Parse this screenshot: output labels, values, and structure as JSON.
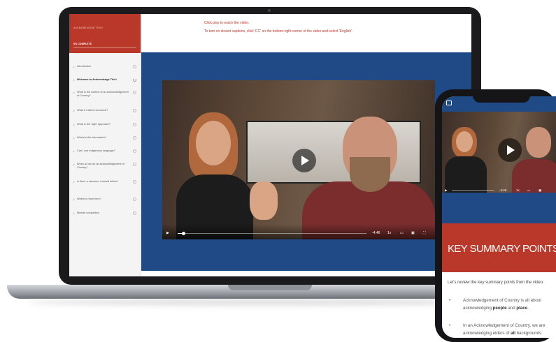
{
  "sidebar": {
    "course_title": "ACKNOWLEDGE THIS!",
    "progress_label": "0% COMPLETE",
    "lessons": [
      {
        "label": "Introduction"
      },
      {
        "label": "Welcome to Acknowledge This!"
      },
      {
        "label": "What is the context of an Acknowledgement of Country?"
      },
      {
        "label": "What if I offend someone?"
      },
      {
        "label": "What is the 'right' approach?"
      },
      {
        "label": "Where's the information?"
      },
      {
        "label": "Can I use Indigenous language?"
      },
      {
        "label": "When do we do an Acknowledgement of Country?"
      },
      {
        "label": "Is there a structure I should follow?"
      },
      {
        "label": "Where to from here?"
      },
      {
        "label": "Module completion"
      }
    ]
  },
  "main": {
    "instruction_line1": "Click play to watch the video.",
    "instruction_line2": "To turn on closed captions, click 'CC' on the bottom-right corner of the video and select 'English'."
  },
  "video": {
    "play_icon": "play-icon",
    "time_remaining": "-4:46",
    "speed": "1x",
    "progress": 0.03
  },
  "phone": {
    "video_time": "-4:46",
    "banner_title": "KEY SUMMARY POINTS",
    "intro": "Let's review the key summary points from the video.",
    "point1_line1": "Acknowledgement of Country is all about",
    "point1_line2_pre": "acknowledging ",
    "point1_line2_b1": "people",
    "point1_line2_mid": " and ",
    "point1_line2_b2": "place",
    "point1_line2_post": ".",
    "point2_line1": "In an Acknowledgement of Country, we are",
    "point2_line2_pre": "acknowledging elders of ",
    "point2_line2_b1": "all",
    "point2_line2_post": " backgrounds"
  }
}
